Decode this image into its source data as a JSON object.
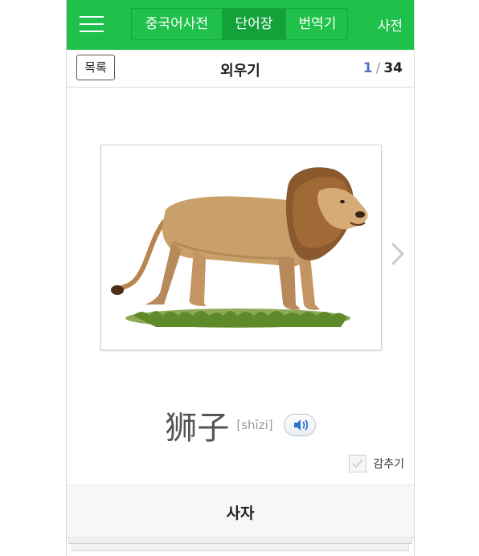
{
  "topbar": {
    "tabs": [
      {
        "label": "중국어사전",
        "active": false
      },
      {
        "label": "단어장",
        "active": true
      },
      {
        "label": "번역기",
        "active": false
      }
    ],
    "dict_label": "사전",
    "accent_color": "#1fc14a"
  },
  "subbar": {
    "list_button": "목록",
    "title": "외우기",
    "counter_current": "1",
    "counter_separator": "/",
    "counter_total": "34"
  },
  "card": {
    "image_icon": "lion-illustration",
    "next_icon": "chevron-right-icon"
  },
  "word": {
    "hanzi": "狮子",
    "pinyin": "[shīzi]",
    "audio_icon": "speaker-icon"
  },
  "hide": {
    "label": "감추기",
    "checked": false
  },
  "meaning": "사자"
}
